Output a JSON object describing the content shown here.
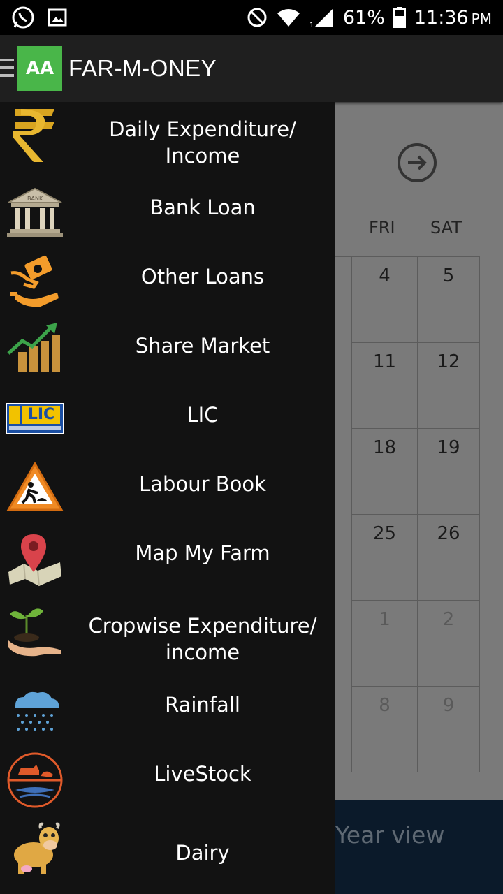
{
  "status_bar": {
    "battery": "61%",
    "time": "11:36",
    "ampm": "PM",
    "icons": [
      "whatsapp-icon",
      "gallery-icon",
      "do-not-disturb-icon",
      "wifi-icon",
      "signal-icon",
      "battery-icon"
    ]
  },
  "app_bar": {
    "logo_text": "AA",
    "title": "FAR-M-ONEY",
    "logo_color": "#49b649"
  },
  "drawer": {
    "items": [
      {
        "label_line1": "Daily Expenditure/",
        "label_line2": "Income",
        "icon": "rupee-icon"
      },
      {
        "label_line1": "Bank Loan",
        "label_line2": "",
        "icon": "bank-icon"
      },
      {
        "label_line1": "Other Loans",
        "label_line2": "",
        "icon": "loan-hand-icon"
      },
      {
        "label_line1": "Share Market",
        "label_line2": "",
        "icon": "share-market-icon"
      },
      {
        "label_line1": "LIC",
        "label_line2": "",
        "icon": "lic-logo-icon"
      },
      {
        "label_line1": "Labour Book",
        "label_line2": "",
        "icon": "labour-sign-icon"
      },
      {
        "label_line1": "Map My Farm",
        "label_line2": "",
        "icon": "map-pin-icon"
      },
      {
        "label_line1": "Cropwise Expenditure/",
        "label_line2": "income",
        "icon": "plant-hand-icon"
      },
      {
        "label_line1": "Rainfall",
        "label_line2": "",
        "icon": "rain-cloud-icon"
      },
      {
        "label_line1": "LiveStock",
        "label_line2": "",
        "icon": "livestock-icon"
      },
      {
        "label_line1": "Dairy",
        "label_line2": "",
        "icon": "cow-icon"
      }
    ],
    "lic_text": "LIC"
  },
  "calendar": {
    "day_headers": [
      "FRI",
      "SAT"
    ],
    "weeks": [
      [
        "4",
        "5"
      ],
      [
        "11",
        "12"
      ],
      [
        "18",
        "19"
      ],
      [
        "25",
        "26"
      ],
      [
        "1",
        "2"
      ],
      [
        "8",
        "9"
      ]
    ],
    "year_view_label": "Year view"
  }
}
